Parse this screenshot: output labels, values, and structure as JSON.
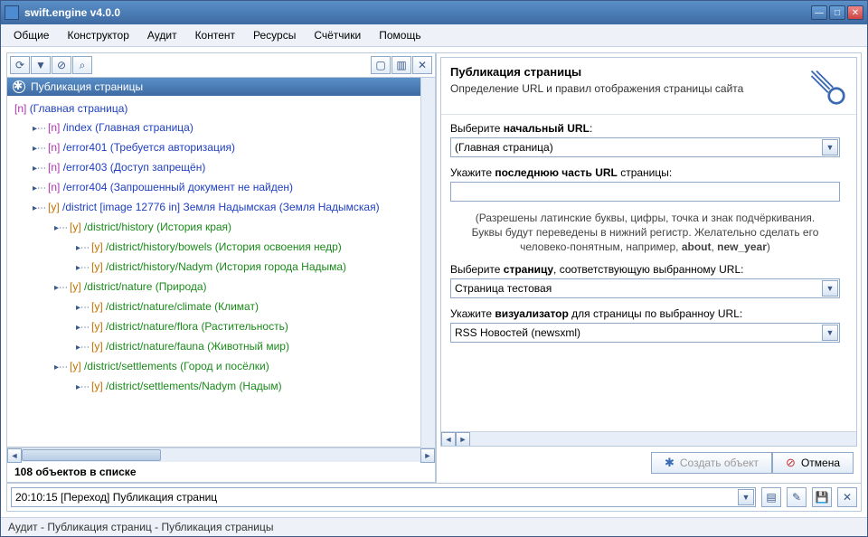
{
  "window": {
    "title": "swift.engine v4.0.0"
  },
  "menu": [
    "Общие",
    "Конструктор",
    "Аудит",
    "Контент",
    "Ресурсы",
    "Счётчики",
    "Помощь"
  ],
  "left": {
    "header": "Публикация страницы",
    "count": "108 объектов в списке",
    "nodes": [
      {
        "lvl": 1,
        "tag": "[n]",
        "path": "",
        "label": "(Главная страница)",
        "cls": ""
      },
      {
        "lvl": 2,
        "tag": "[n]",
        "path": "/index",
        "label": "(Главная страница)",
        "cls": ""
      },
      {
        "lvl": 2,
        "tag": "[n]",
        "path": "/error401",
        "label": "(Требуется авторизация)",
        "cls": ""
      },
      {
        "lvl": 2,
        "tag": "[n]",
        "path": "/error403",
        "label": "(Доступ запрещён)",
        "cls": ""
      },
      {
        "lvl": 2,
        "tag": "[n]",
        "path": "/error404",
        "label": "(Запрошенный документ не найден)",
        "cls": ""
      },
      {
        "lvl": 2,
        "tag": "[y]",
        "path": "/district [image 12776 in] Земля Надымская",
        "label": "(Земля Надымская)",
        "cls": ""
      },
      {
        "lvl": 3,
        "tag": "[y]",
        "path": "/district/history",
        "label": "(История края)",
        "cls": "green"
      },
      {
        "lvl": 4,
        "tag": "[y]",
        "path": "/district/history/bowels",
        "label": "(История освоения недр)",
        "cls": "green"
      },
      {
        "lvl": 4,
        "tag": "[y]",
        "path": "/district/history/Nadym",
        "label": "(История города Надыма)",
        "cls": "green"
      },
      {
        "lvl": 3,
        "tag": "[y]",
        "path": "/district/nature",
        "label": "(Природа)",
        "cls": "green"
      },
      {
        "lvl": 4,
        "tag": "[y]",
        "path": "/district/nature/climate",
        "label": "(Климат)",
        "cls": "green"
      },
      {
        "lvl": 4,
        "tag": "[y]",
        "path": "/district/nature/flora",
        "label": "(Растительность)",
        "cls": "green"
      },
      {
        "lvl": 4,
        "tag": "[y]",
        "path": "/district/nature/fauna",
        "label": "(Животный мир)",
        "cls": "green"
      },
      {
        "lvl": 3,
        "tag": "[y]",
        "path": "/district/settlements",
        "label": "(Город и посёлки)",
        "cls": "green"
      },
      {
        "lvl": 4,
        "tag": "[y]",
        "path": "/district/settlements/Nadym",
        "label": "(Надым)",
        "cls": "green"
      }
    ]
  },
  "form": {
    "title": "Публикация страницы",
    "subtitle": "Определение URL и правил отображения страницы сайта",
    "f1_label_a": "Выберите ",
    "f1_label_b": "начальный URL",
    "f1_label_c": ":",
    "f1_value": "(Главная страница)",
    "f2_label_a": "Укажите ",
    "f2_label_b": "последнюю часть URL",
    "f2_label_c": " страницы:",
    "f2_value": "",
    "hint1": "(Разрешены латинские буквы, цифры, точка и знак подчёркивания.",
    "hint2_a": "Буквы будут переведены в нижний регистр. Желательно сделать его человеко-понятным, например, ",
    "hint2_b": "about",
    "hint2_c": ", ",
    "hint2_d": "new_year",
    "hint2_e": ")",
    "f3_label_a": "Выберите ",
    "f3_label_b": "страницу",
    "f3_label_c": ", соответствующую выбранному URL:",
    "f3_value": "Страница тестовая",
    "f4_label_a": "Укажите ",
    "f4_label_b": "визуализатор",
    "f4_label_c": " для страницы по выбранноу URL:",
    "f4_value": "RSS Новостей (newsxml)",
    "btn_create": "Создать объект",
    "btn_cancel": "Отмена"
  },
  "status": {
    "combo": "20:10:15 [Переход] Публикация страниц",
    "bar": "Аудит - Публикация страниц -  Публикация страницы"
  }
}
